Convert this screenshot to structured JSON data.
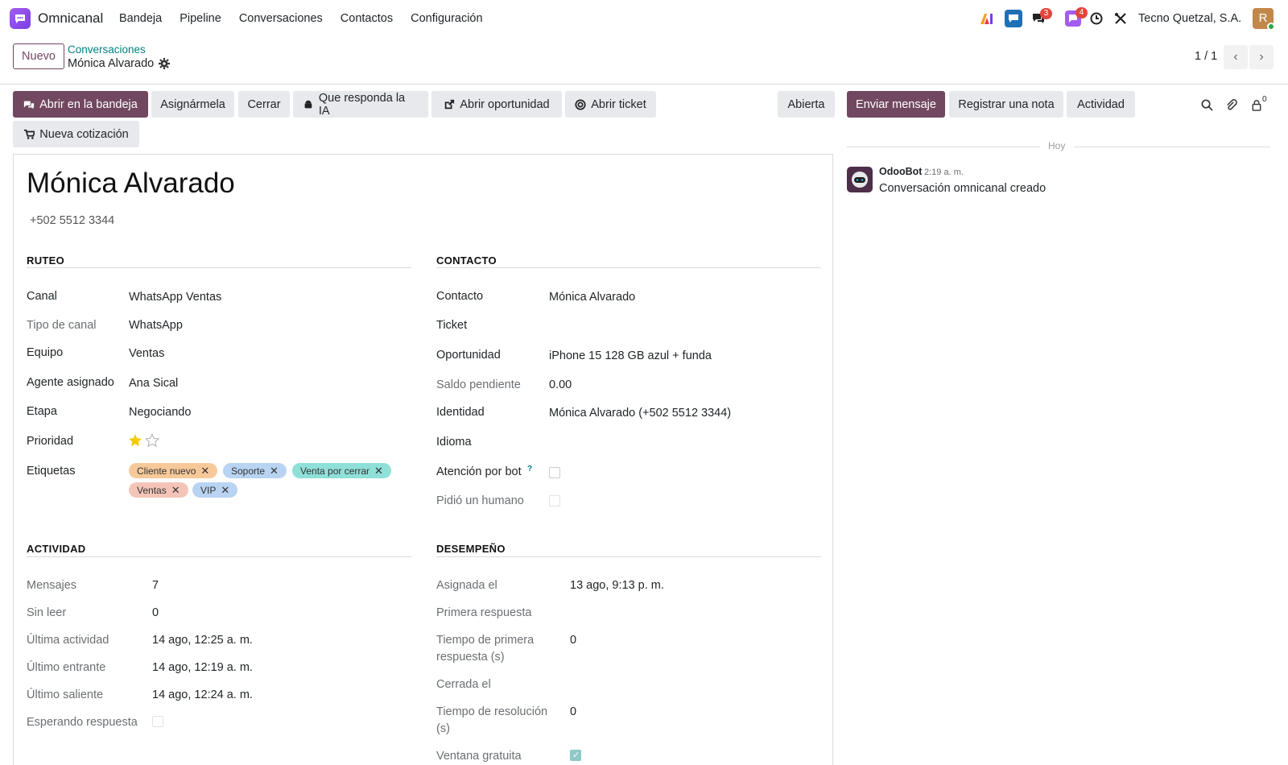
{
  "navbar": {
    "app_name": "Omnicanal",
    "menu": [
      "Bandeja",
      "Pipeline",
      "Conversaciones",
      "Contactos",
      "Configuración"
    ],
    "messages_badge": "3",
    "activity_badge": "4",
    "company": "Tecno Quetzal, S.A.",
    "avatar_initial": "R"
  },
  "control": {
    "new_label": "Nuevo",
    "breadcrumb_parent": "Conversaciones",
    "breadcrumb_current": "Mónica Alvarado",
    "pager": "1 / 1"
  },
  "actions": {
    "open_inbox": "Abrir en la bandeja",
    "assign_me": "Asignármela",
    "close": "Cerrar",
    "ai_reply": "Que responda la IA",
    "open_opportunity": "Abrir oportunidad",
    "open_ticket": "Abrir ticket",
    "new_quote": "Nueva cotización",
    "status": "Abierta"
  },
  "form": {
    "title": "Mónica Alvarado",
    "phone": "+502 5512 3344",
    "routing": {
      "heading": "RUTEO",
      "channel_label": "Canal",
      "channel": "WhatsApp Ventas",
      "channel_type_label": "Tipo de canal",
      "channel_type": "WhatsApp",
      "team_label": "Equipo",
      "team": "Ventas",
      "agent_label": "Agente asignado",
      "agent": "Ana Sical",
      "stage_label": "Etapa",
      "stage": "Negociando",
      "priority_label": "Prioridad",
      "priority_stars": 1,
      "tags_label": "Etiquetas",
      "tags": [
        {
          "name": "Cliente nuevo",
          "color": "#f7c99a"
        },
        {
          "name": "Soporte",
          "color": "#b9d3f2"
        },
        {
          "name": "Venta por cerrar",
          "color": "#8ee0d9"
        },
        {
          "name": "Ventas",
          "color": "#f5c4b8"
        },
        {
          "name": "VIP",
          "color": "#b9d3f2"
        }
      ]
    },
    "contact": {
      "heading": "CONTACTO",
      "contact_label": "Contacto",
      "contact": "Mónica Alvarado",
      "ticket_label": "Ticket",
      "ticket": "",
      "opportunity_label": "Oportunidad",
      "opportunity": "iPhone 15 128 GB azul + funda",
      "balance_label": "Saldo pendiente",
      "balance": "0.00",
      "identity_label": "Identidad",
      "identity": "Mónica Alvarado (+502 5512 3344)",
      "language_label": "Idioma",
      "language": "",
      "bot_label": "Atención por bot",
      "bot_help": "?",
      "bot": false,
      "human_label": "Pidió un humano",
      "human": false
    },
    "activity": {
      "heading": "ACTIVIDAD",
      "messages_label": "Mensajes",
      "messages": "7",
      "unread_label": "Sin leer",
      "unread": "0",
      "last_activity_label": "Última actividad",
      "last_activity": "14 ago, 12:25 a. m.",
      "last_in_label": "Último entrante",
      "last_in": "14 ago, 12:19 a. m.",
      "last_out_label": "Último saliente",
      "last_out": "14 ago, 12:24 a. m.",
      "waiting_label": "Esperando respuesta",
      "waiting": false
    },
    "performance": {
      "heading": "DESEMPEÑO",
      "assigned_label": "Asignada el",
      "assigned": "13 ago, 9:13 p. m.",
      "first_response_label": "Primera respuesta",
      "first_response": "",
      "frt_label_1": "Tiempo de primera",
      "frt_label_2": "respuesta (s)",
      "frt": "0",
      "closed_label": "Cerrada el",
      "closed": "",
      "resolution_label_1": "Tiempo de resolución",
      "resolution_label_2": "(s)",
      "resolution": "0",
      "free_window_label": "Ventana gratuita",
      "free_window": true
    }
  },
  "chatter": {
    "send_message": "Enviar mensaje",
    "log_note": "Registrar una nota",
    "activity": "Actividad",
    "followers_count": "0",
    "today": "Hoy",
    "message": {
      "author": "OdooBot",
      "time": "2:19 a. m.",
      "body": "Conversación omnicanal creado"
    }
  }
}
